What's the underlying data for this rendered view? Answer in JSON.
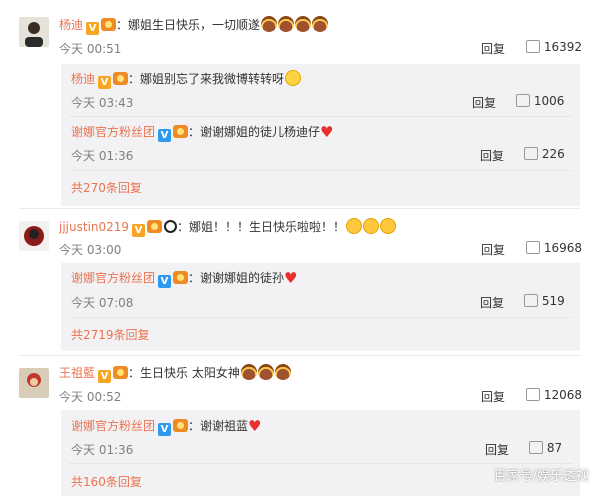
{
  "comments": [
    {
      "name": "杨迪",
      "text": "：娜姐生日快乐，一切顺遂",
      "time": "今天 00:51",
      "reply_label": "回复",
      "likes": "16392",
      "replies": [
        {
          "name": "杨迪",
          "text": "：娜姐别忘了来我微博转转呀",
          "time": "今天 03:43",
          "reply_label": "回复",
          "likes": "1006"
        },
        {
          "name": "谢娜官方粉丝团",
          "text": "：谢谢娜姐的徒儿杨迪仔",
          "time": "今天 01:36",
          "reply_label": "回复",
          "likes": "226"
        }
      ],
      "more_label": "共270条回复"
    },
    {
      "name": "jjjustin0219",
      "text": "：娜姐！！！生日快乐啦啦！！",
      "time": "今天 03:00",
      "reply_label": "回复",
      "likes": "16968",
      "replies": [
        {
          "name": "谢娜官方粉丝团",
          "text": "：谢谢娜姐的徒孙",
          "time": "今天 07:08",
          "reply_label": "回复",
          "likes": "519"
        }
      ],
      "more_label": "共2719条回复"
    },
    {
      "name": "王祖藍",
      "text": "：生日快乐 太阳女神",
      "time": "今天 00:52",
      "reply_label": "回复",
      "likes": "12068",
      "replies": [
        {
          "name": "谢娜官方粉丝团",
          "text": "：谢谢祖蓝",
          "time": "今天 01:36",
          "reply_label": "回复",
          "likes": "87"
        }
      ],
      "more_label": "共160条回复"
    }
  ],
  "watermark": "百家号/娱乐透视",
  "colors": {
    "name": "#eb7350",
    "sub_panel_bg": "#f2f2f5",
    "heart": "#e8302f"
  }
}
